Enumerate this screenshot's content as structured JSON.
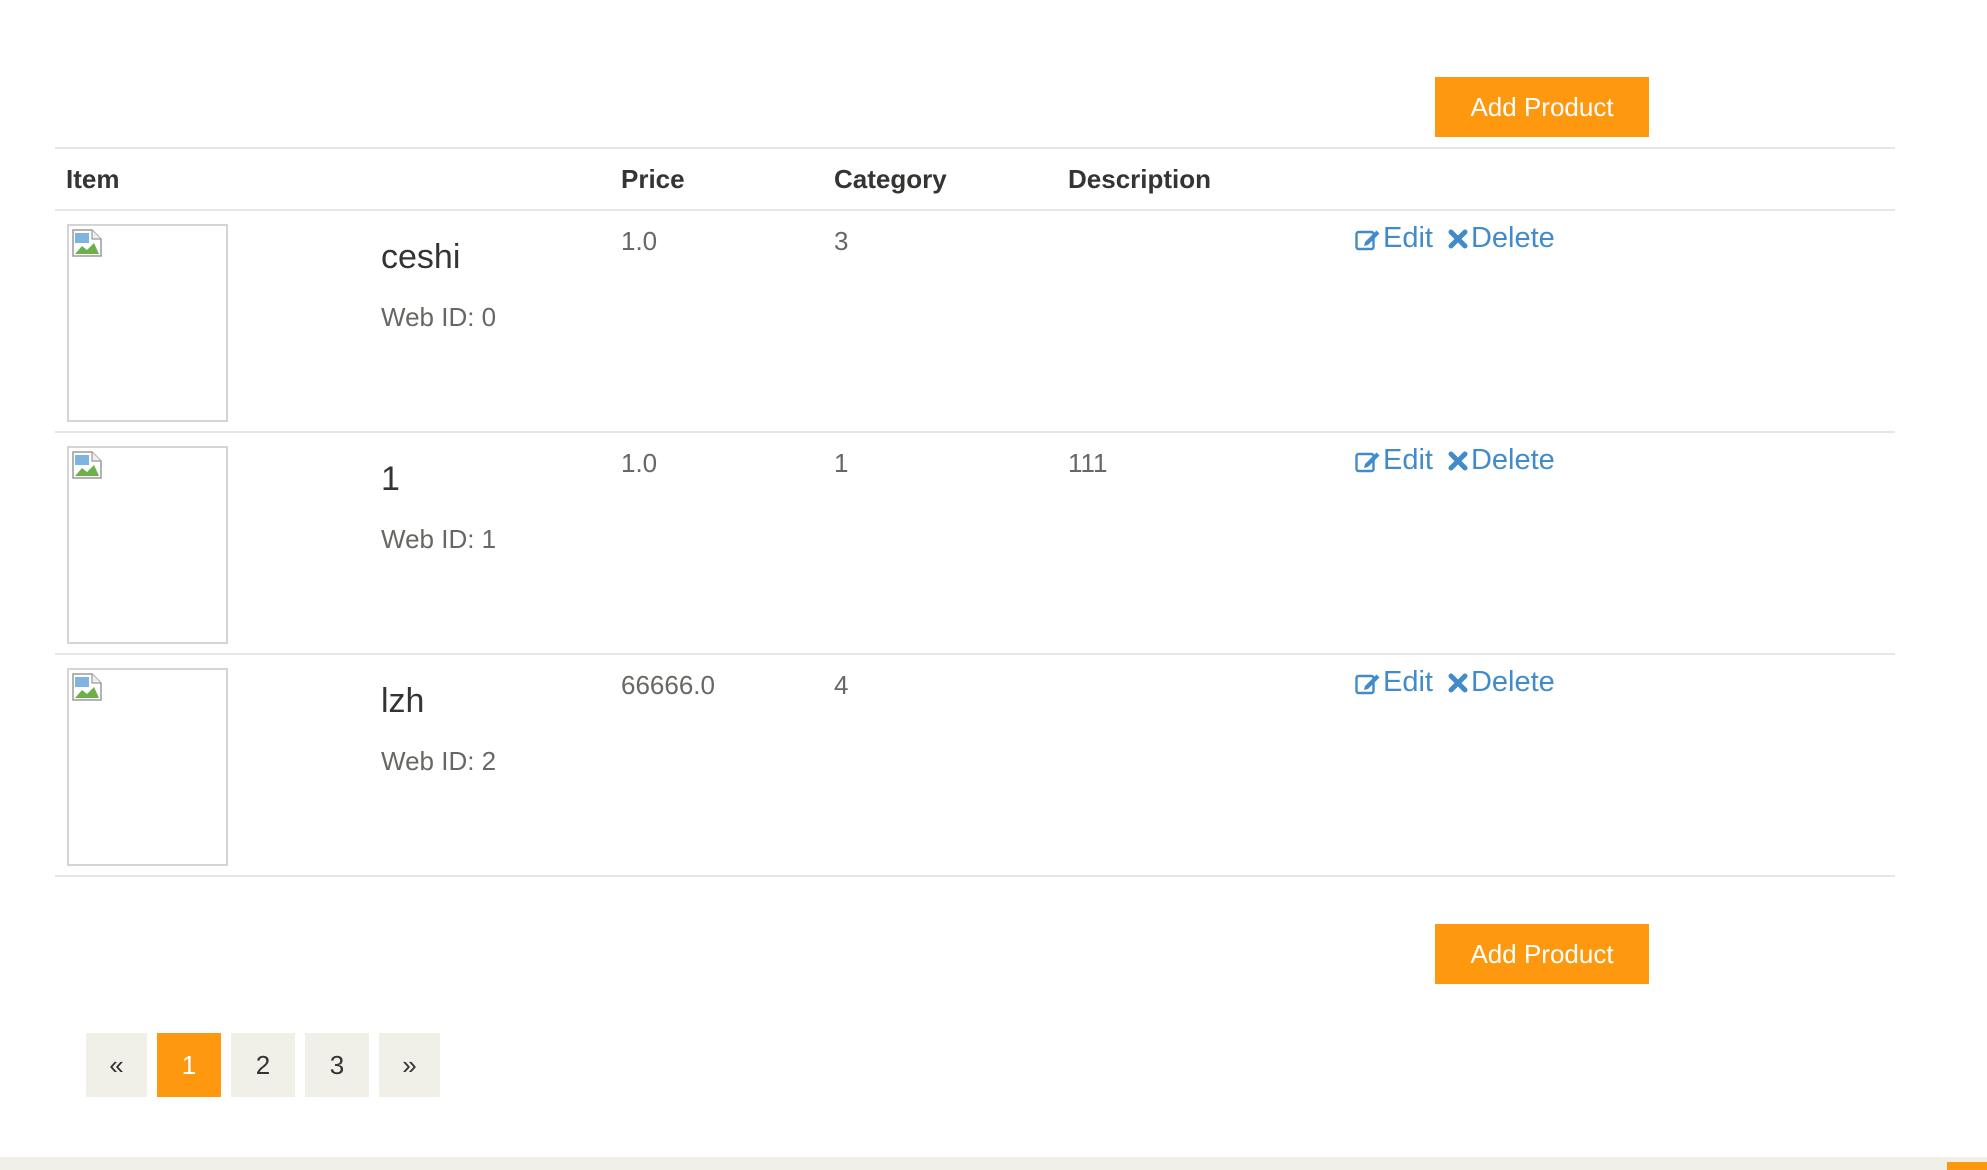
{
  "toolbar": {
    "add_label_top": "Add Product",
    "add_label_bottom": "Add Product"
  },
  "table": {
    "headers": {
      "item": "Item",
      "price": "Price",
      "category": "Category",
      "description": "Description"
    },
    "rows": [
      {
        "name": "ceshi",
        "web_id": "Web ID: 0",
        "price": "1.0",
        "category": "3",
        "description": "",
        "edit_label": "Edit",
        "delete_label": "Delete"
      },
      {
        "name": "1",
        "web_id": "Web ID: 1",
        "price": "1.0",
        "category": "1",
        "description": "111",
        "edit_label": "Edit",
        "delete_label": "Delete"
      },
      {
        "name": "lzh",
        "web_id": "Web ID: 2",
        "price": "66666.0",
        "category": "4",
        "description": "",
        "edit_label": "Edit",
        "delete_label": "Delete"
      }
    ]
  },
  "pagination": {
    "prev": "«",
    "pages": [
      "1",
      "2",
      "3"
    ],
    "current": "1",
    "next": "»"
  },
  "colors": {
    "accent": "#fe980f",
    "link": "#428bca",
    "pager_bg": "#f0f0e9"
  },
  "icons": {
    "edit": "edit-icon",
    "delete": "delete-icon",
    "thumbnail": "broken-image-icon"
  }
}
